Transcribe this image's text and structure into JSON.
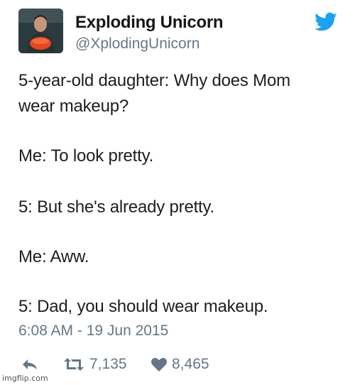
{
  "author": {
    "display_name": "Exploding Unicorn",
    "handle": "@XplodingUnicorn",
    "avatar_icon": "profile-photo"
  },
  "brand": {
    "icon": "twitter-bird-icon",
    "color": "#1da1f2"
  },
  "tweet": {
    "lines": [
      "5-year-old daughter: Why does Mom",
      "wear makeup?",
      "Me: To look pretty.",
      "5: But she's already pretty.",
      "Me: Aww.",
      "5: Dad, you should wear makeup."
    ],
    "timestamp": "6:08 AM - 19 Jun 2015"
  },
  "actions": {
    "reply_icon": "reply-icon",
    "retweet_icon": "retweet-icon",
    "retweet_count": "7,135",
    "like_icon": "heart-icon",
    "like_count": "8,465"
  },
  "watermark": "imgflip.com",
  "colors": {
    "text": "#1c1e21",
    "muted": "#657786",
    "accent": "#1da1f2"
  }
}
